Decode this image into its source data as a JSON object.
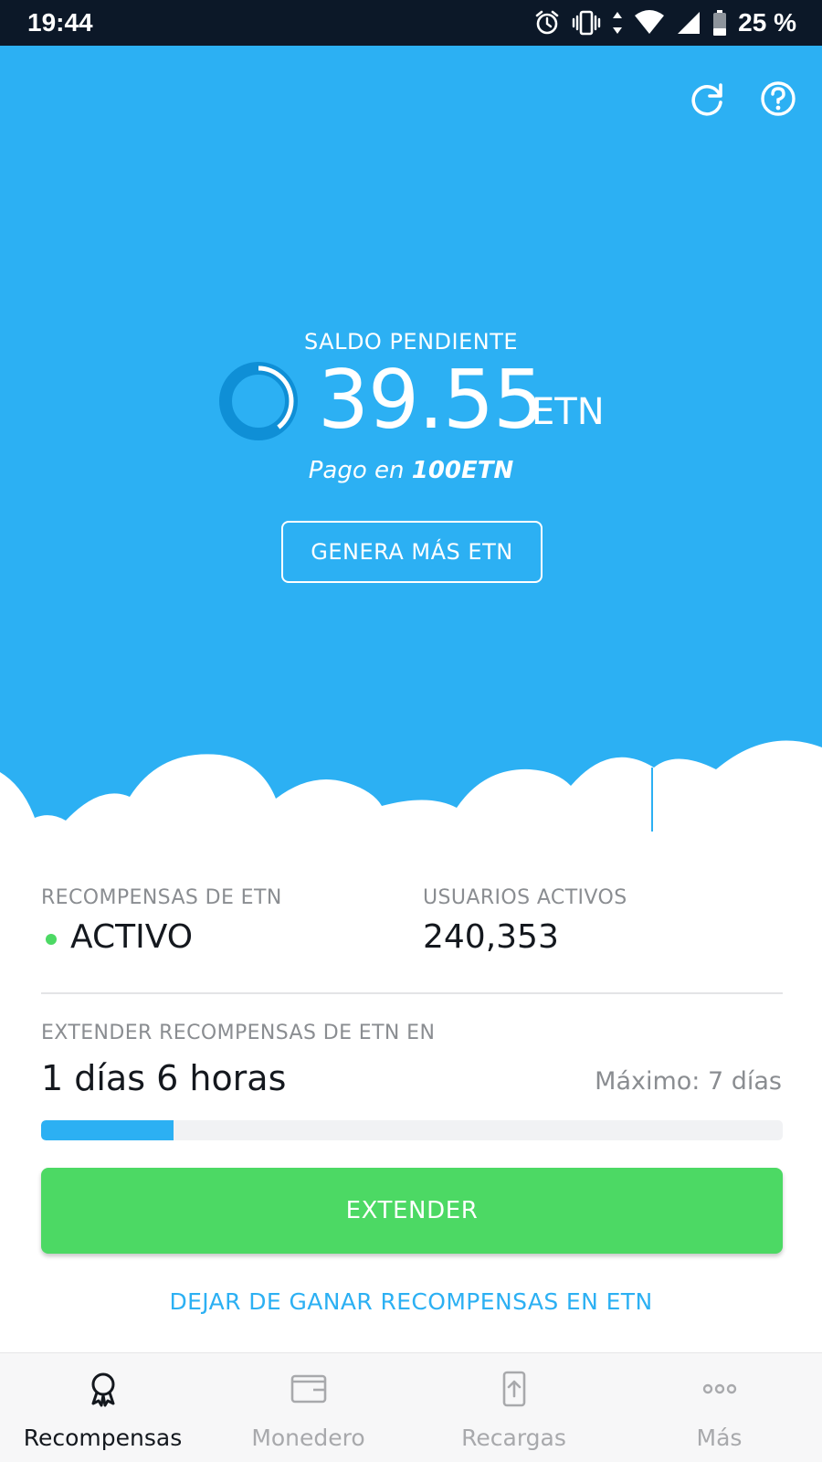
{
  "status_bar": {
    "time": "19:44",
    "battery": "25 %"
  },
  "hero": {
    "saldo_label": "SALDO PENDIENTE",
    "amount": "39.55",
    "unit": "ETN",
    "payout_prefix": "Pago en",
    "payout_amount": "100ETN",
    "payout_progress_fraction": 0.3955,
    "generate_label": "GENERA MÁS ETN"
  },
  "stats": {
    "rewards_label": "RECOMPENSAS DE ETN",
    "rewards_status": "ACTIVO",
    "users_label": "USUARIOS ACTIVOS",
    "users_value": "240,353"
  },
  "extend": {
    "label": "EXTENDER RECOMPENSAS DE ETN EN",
    "time": "1 días 6 horas",
    "max": "Máximo: 7 días",
    "progress_fraction": 0.178,
    "button": "EXTENDER",
    "stop_link": "DEJAR DE GANAR RECOMPENSAS EN ETN"
  },
  "nav": {
    "items": [
      {
        "label": "Recompensas",
        "icon": "award-icon",
        "active": true
      },
      {
        "label": "Monedero",
        "icon": "wallet-icon",
        "active": false
      },
      {
        "label": "Recargas",
        "icon": "topup-icon",
        "active": false
      },
      {
        "label": "Más",
        "icon": "more-icon",
        "active": false
      }
    ]
  },
  "colors": {
    "hero_blue": "#2cb0f3",
    "ring_dark": "#0f8fd6",
    "green": "#4cd964",
    "status_bar": "#0c1828"
  }
}
